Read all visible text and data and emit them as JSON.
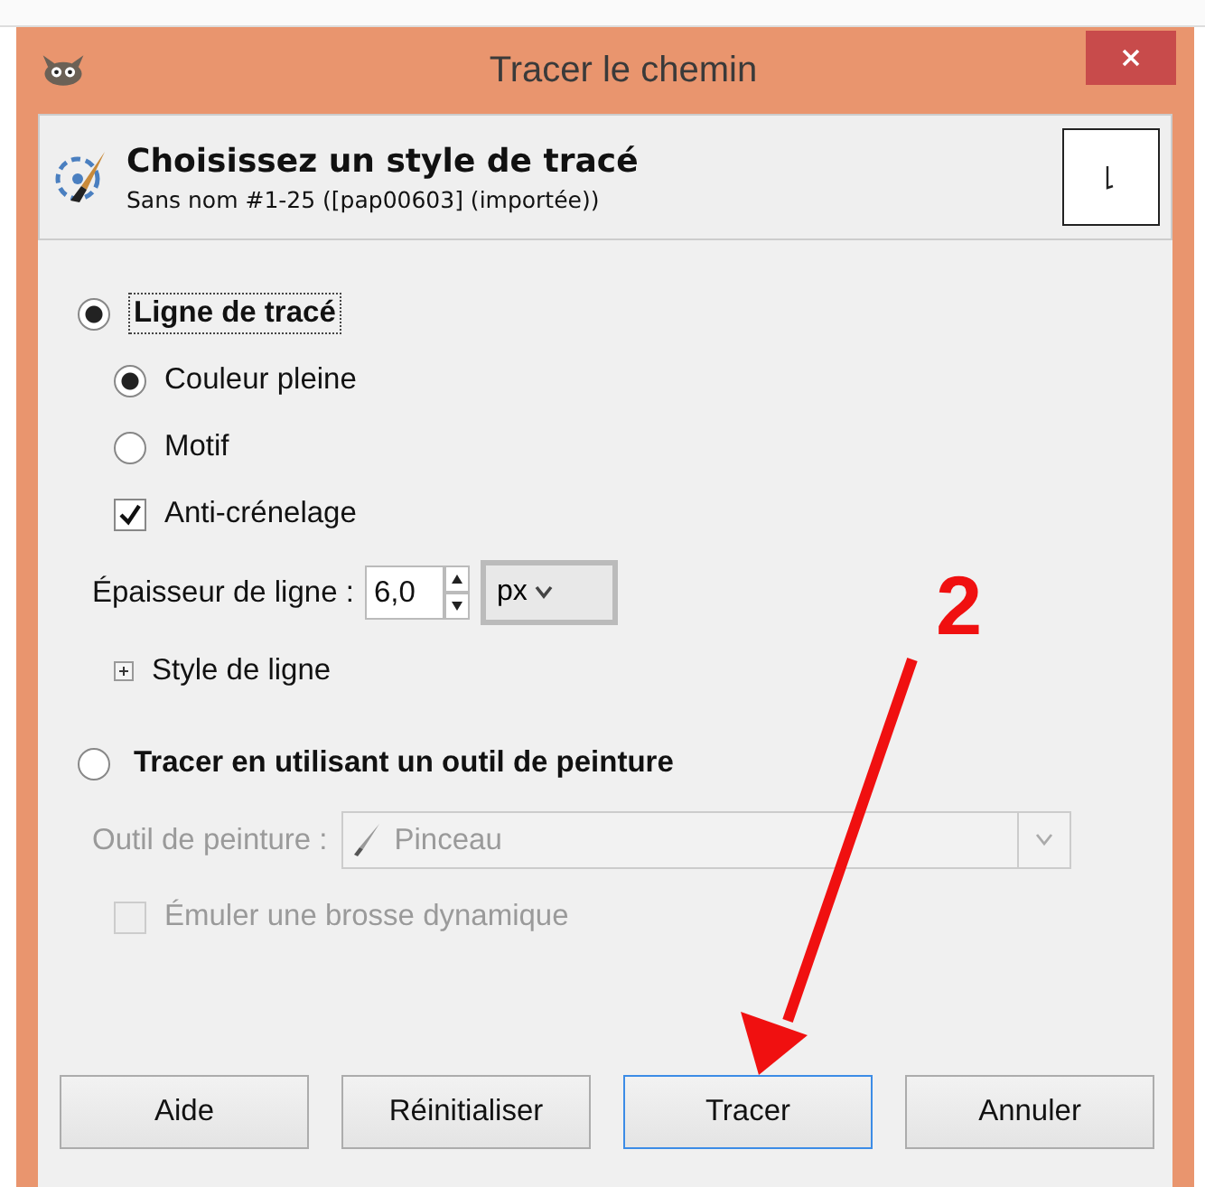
{
  "window": {
    "title": "Tracer le chemin"
  },
  "header": {
    "title": "Choisissez un style de tracé",
    "subtitle": "Sans nom #1-25 ([pap00603] (importée))"
  },
  "modes": [
    {
      "label": "Ligne de tracé",
      "selected": true,
      "focused": true
    },
    {
      "label": "Tracer en utilisant un outil de peinture",
      "selected": false,
      "focused": false
    }
  ],
  "fill_options": [
    {
      "label": "Couleur pleine",
      "selected": true
    },
    {
      "label": "Motif",
      "selected": false
    }
  ],
  "antialias": {
    "label": "Anti-crénelage",
    "checked": true
  },
  "line_width": {
    "label": "Épaisseur de ligne :",
    "value": "6,0",
    "unit": "px"
  },
  "line_style": {
    "label": "Style de ligne",
    "expanded": false
  },
  "paint_tool": {
    "label": "Outil de peinture :",
    "value": "Pinceau",
    "disabled": true
  },
  "emulate": {
    "label": "Émuler une brosse dynamique",
    "checked": false,
    "disabled": true
  },
  "buttons": [
    {
      "label": "Aide",
      "focused": false
    },
    {
      "label": "Réinitialiser",
      "focused": false
    },
    {
      "label": "Tracer",
      "focused": true
    },
    {
      "label": "Annuler",
      "focused": false
    }
  ],
  "annotation": {
    "label": "2"
  }
}
